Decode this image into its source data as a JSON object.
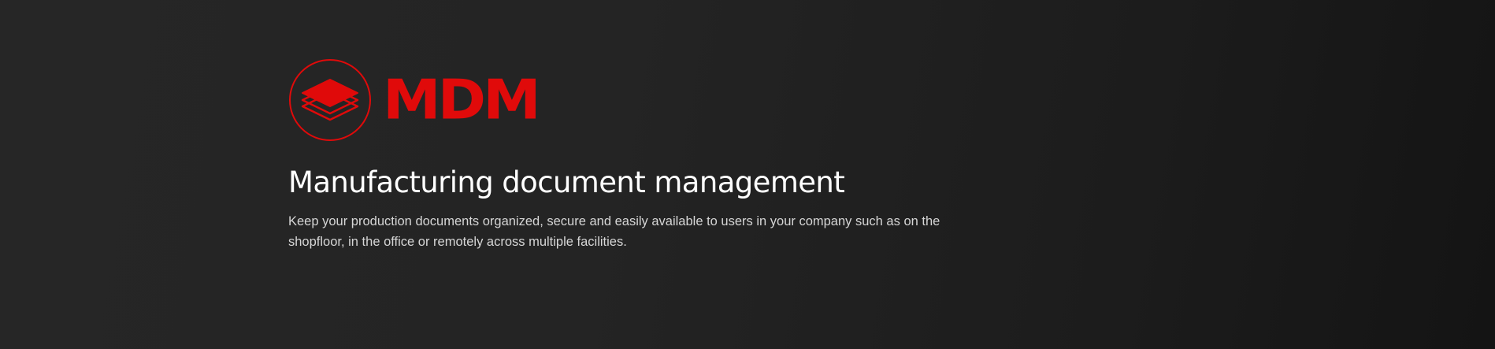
{
  "hero": {
    "logo": {
      "icon": "layers-icon",
      "wordmark": "MDM",
      "color": "#e00a0a"
    },
    "title": "Manufacturing document management",
    "description": "Keep your production documents organized, secure and easily available to users in your company such as on the shopfloor, in the office or remotely across multiple facilities."
  }
}
